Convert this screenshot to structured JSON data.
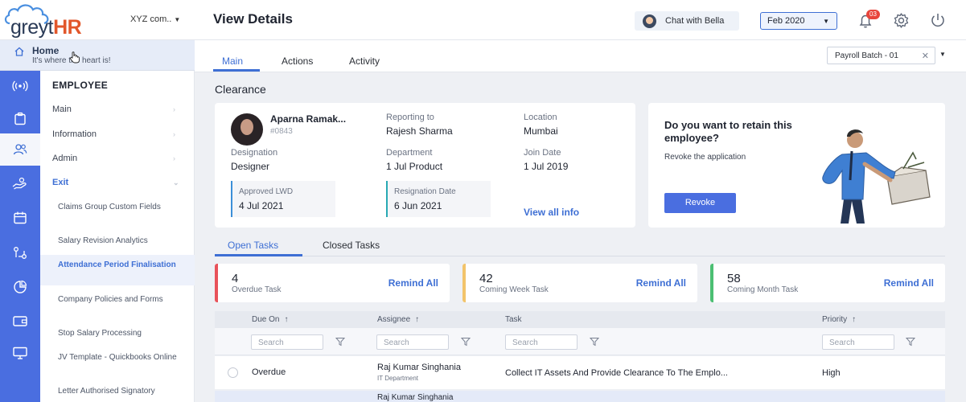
{
  "header": {
    "brand_main": "greyt",
    "brand_accent": "HR",
    "company": "XYZ com..",
    "page_title": "View Details",
    "chat_label": "Chat with Bella",
    "period": "Feb 2020",
    "notification_count": "03"
  },
  "home": {
    "label": "Home",
    "tagline": "It's where the heart is!"
  },
  "sidebar": {
    "section_title": "EMPLOYEE",
    "groups": [
      {
        "label": "Main"
      },
      {
        "label": "Information"
      },
      {
        "label": "Admin"
      },
      {
        "label": "Exit"
      }
    ],
    "exit_items": [
      {
        "label": "Claims Group Custom Fields"
      },
      {
        "label": "Salary Revision Analytics"
      },
      {
        "label": "Attendance Period Finalisation"
      },
      {
        "label": "Company Policies and Forms"
      },
      {
        "label": "Stop Salary Processing"
      },
      {
        "label": "JV Template - Quickbooks Online"
      },
      {
        "label": "Letter Authorised Signatory"
      }
    ]
  },
  "tabs": [
    {
      "label": "Main"
    },
    {
      "label": "Actions"
    },
    {
      "label": "Activity"
    }
  ],
  "payroll_batch": "Payroll Batch - 01",
  "section_title": "Clearance",
  "employee": {
    "name": "Aparna Ramak...",
    "id": "#0843",
    "reporting_to_label": "Reporting to",
    "reporting_to": "Rajesh Sharma",
    "location_label": "Location",
    "location": "Mumbai",
    "designation_label": "Designation",
    "designation": "Designer",
    "department_label": "Department",
    "department": "1 Jul Product",
    "join_date_label": "Join Date",
    "join_date": "1 Jul 2019",
    "approved_lwd_label": "Approved LWD",
    "approved_lwd": "4 Jul 2021",
    "resignation_date_label": "Resignation Date",
    "resignation_date": "6 Jun 2021",
    "view_all": "View all info"
  },
  "retain": {
    "question": "Do you want to retain this employee?",
    "subtitle": "Revoke the application",
    "button": "Revoke"
  },
  "task_tabs": [
    {
      "label": "Open Tasks"
    },
    {
      "label": "Closed Tasks"
    }
  ],
  "stats": [
    {
      "count": "4",
      "label": "Overdue Task",
      "action": "Remind All",
      "color": "#e8525a"
    },
    {
      "count": "42",
      "label": "Coming Week Task",
      "action": "Remind All",
      "color": "#f2c46b"
    },
    {
      "count": "58",
      "label": "Coming Month Task",
      "action": "Remind All",
      "color": "#4cbf73"
    }
  ],
  "table": {
    "columns": [
      {
        "label": "Due On"
      },
      {
        "label": "Assignee"
      },
      {
        "label": "Task"
      },
      {
        "label": "Priority"
      }
    ],
    "search_placeholder": "Search",
    "rows": [
      {
        "due_on": "Overdue",
        "assignee": "Raj Kumar Singhania",
        "dept": "IT Department",
        "task": "Collect IT Assets And Provide Clearance To The Emplo...",
        "priority": "High"
      },
      {
        "assignee": "Raj Kumar Singhania"
      }
    ]
  },
  "colors": {
    "accent": "#3e6fd4",
    "rail": "#4a6ee0",
    "brand_orange": "#e2572b"
  }
}
